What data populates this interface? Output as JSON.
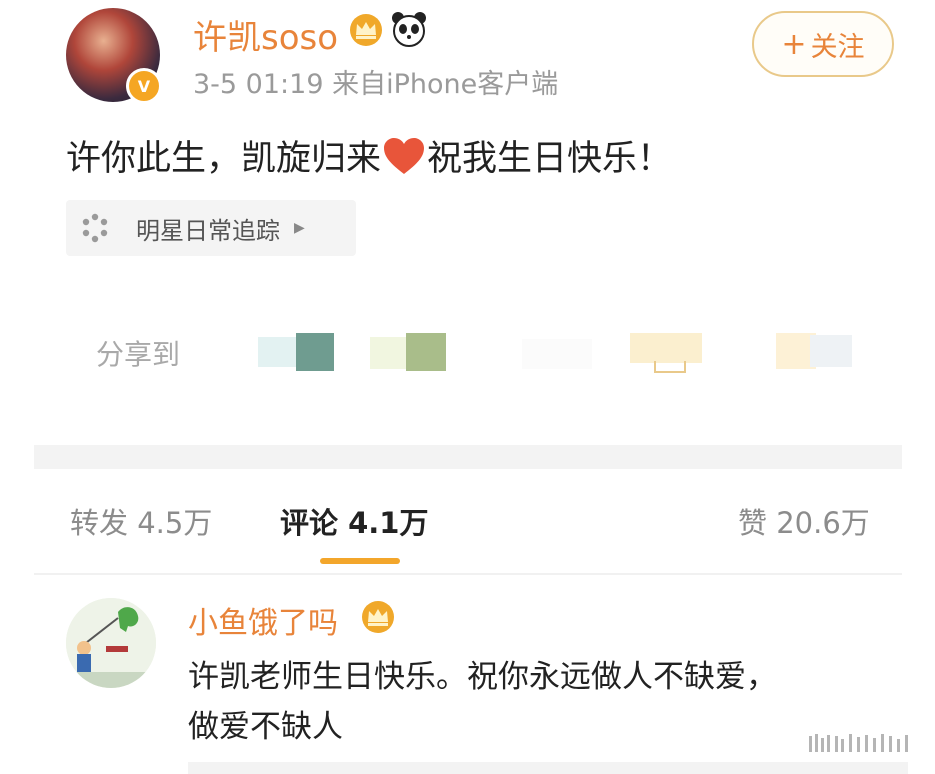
{
  "post": {
    "username": "许凯soso",
    "meta": "3-5 01:19  来自iPhone客户端",
    "follow_label": "关注",
    "text_before": "许你此生，凯旋归来",
    "text_after": "祝我生日快乐！",
    "topic": "明星日常追踪",
    "share_label": "分享到"
  },
  "tabs": {
    "reposts": "转发 4.5万",
    "comments": "评论 4.1万",
    "likes": "赞 20.6万"
  },
  "comment": {
    "username": "小鱼饿了吗",
    "text_line1": "许凯老师生日快乐。祝你永远做人不缺爱，",
    "text_line2": "做爱不缺人"
  },
  "colors": {
    "accent": "#e8843a",
    "tab_underline": "#f3a62b",
    "heart": "#e8553a"
  },
  "icons": [
    "verified-v-icon",
    "crown-icon",
    "panda-icon",
    "heart-icon",
    "topic-dots-icon",
    "arrow-right-icon"
  ]
}
